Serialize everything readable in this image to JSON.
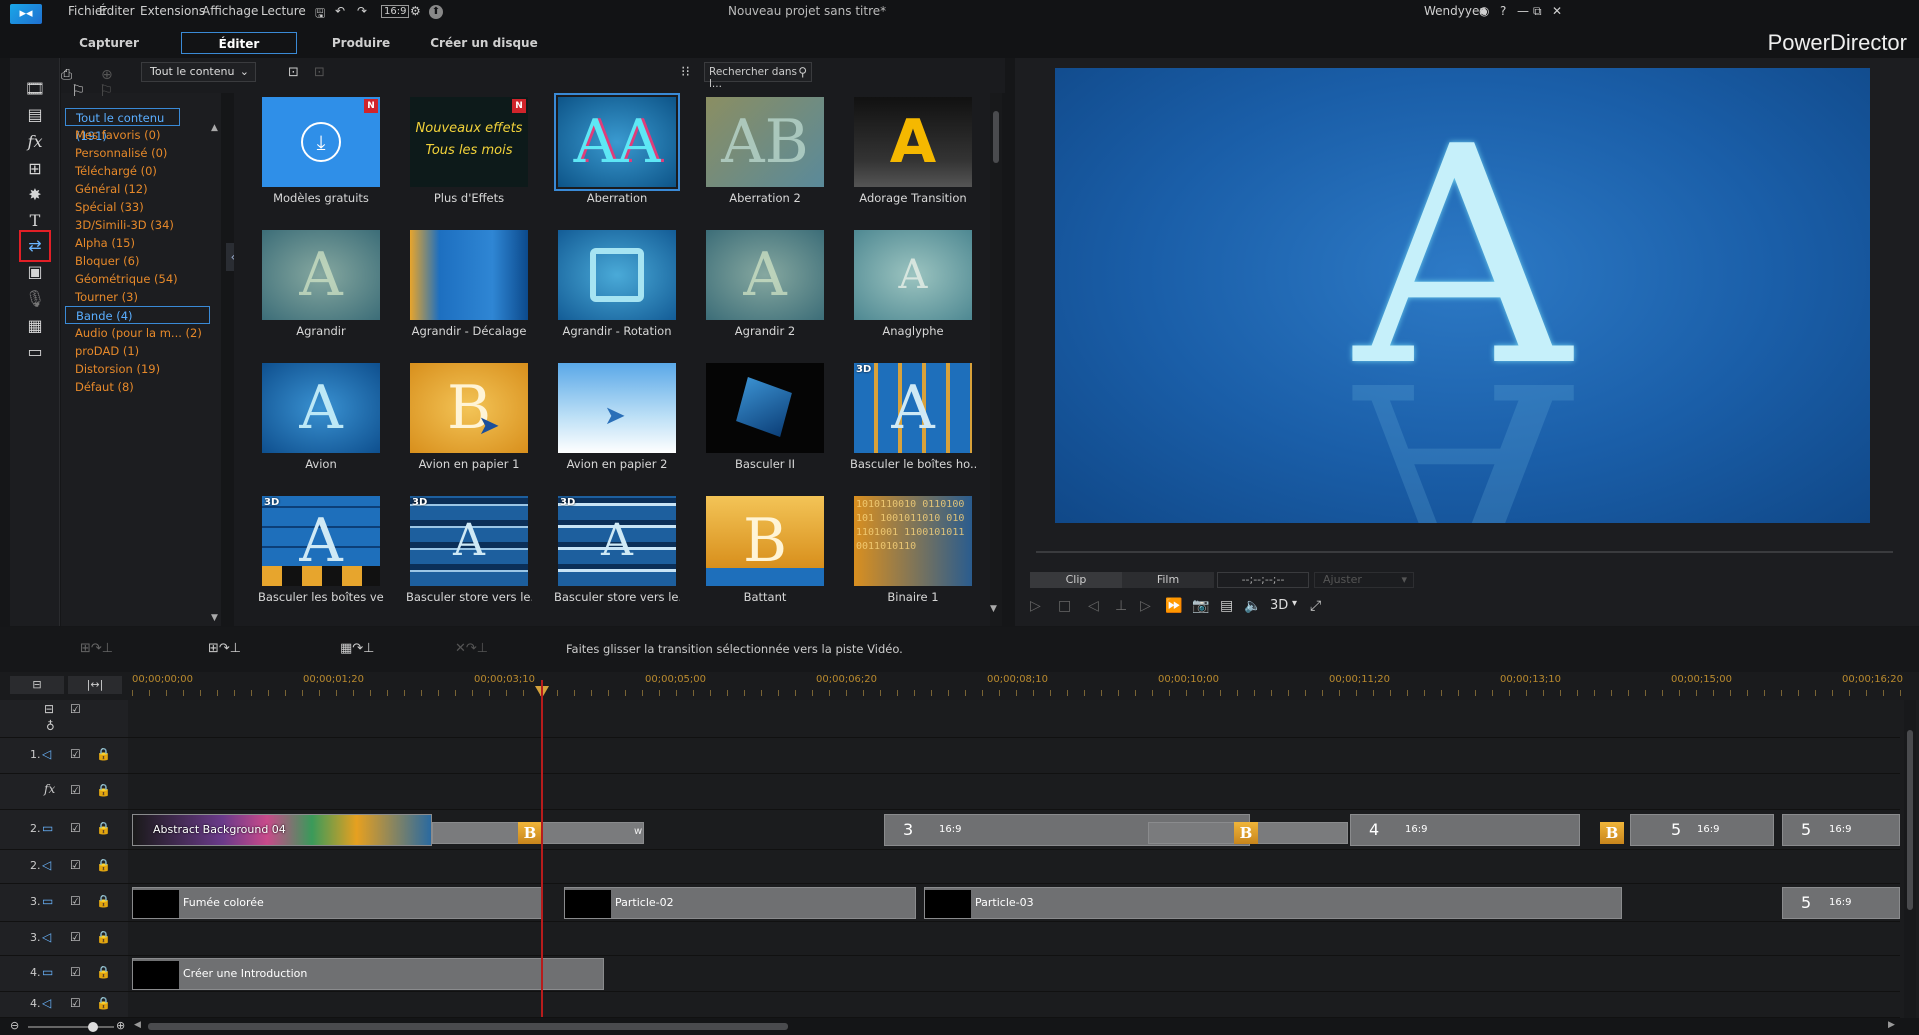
{
  "menubar": {
    "items": [
      "Fichier",
      "Éditer",
      "Extensions",
      "Affichage",
      "Lecture"
    ],
    "project_title": "Nouveau projet sans titre*",
    "user": "Wendyyen"
  },
  "modes": [
    "Capturer",
    "Éditer",
    "Produire",
    "Créer un disque"
  ],
  "brand": "PowerDirector",
  "library": {
    "filter_label": "Tout le contenu",
    "search_placeholder": "Rechercher dans l..."
  },
  "categories": [
    "Tout le contenu (191)",
    "Mes favoris (0)",
    "Personnalisé (0)",
    "Téléchargé (0)",
    "Général (12)",
    "Spécial (33)",
    "3D/Simili-3D (34)",
    "Alpha (15)",
    "Bloquer (6)",
    "Géométrique (54)",
    "Tourner (3)",
    "Bande (4)",
    "Audio (pour la m... (2)",
    "proDAD (1)",
    "Distorsion (19)",
    "Défaut (8)"
  ],
  "tiles": [
    {
      "label": "Modèles gratuits",
      "badge": "N"
    },
    {
      "label": "Plus d'Effets",
      "badge": "N",
      "line1": "Nouveaux effets",
      "line2": "Tous les mois"
    },
    {
      "label": "Aberration",
      "glyph": "AA"
    },
    {
      "label": "Aberration 2",
      "glyph": "AB"
    },
    {
      "label": "Adorage Transition",
      "glyph": "A"
    },
    {
      "label": "Agrandir",
      "glyph": "A"
    },
    {
      "label": "Agrandir - Décalage"
    },
    {
      "label": "Agrandir - Rotation"
    },
    {
      "label": "Agrandir 2",
      "glyph": "A"
    },
    {
      "label": "Anaglyphe",
      "glyph": "A"
    },
    {
      "label": "Avion",
      "glyph": "A"
    },
    {
      "label": "Avion en papier 1",
      "glyph": "B"
    },
    {
      "label": "Avion en papier 2"
    },
    {
      "label": "Basculer II"
    },
    {
      "label": "Basculer le boîtes ho...",
      "badge3d": "3D",
      "glyph": "A"
    },
    {
      "label": "Basculer les boîtes ve...",
      "badge3d": "3D",
      "glyph": "A"
    },
    {
      "label": "Basculer store vers le...",
      "badge3d": "3D",
      "glyph": "A"
    },
    {
      "label": "Basculer store vers le...",
      "badge3d": "3D",
      "glyph": "A"
    },
    {
      "label": "Battant",
      "glyph": "B"
    },
    {
      "label": "Binaire 1",
      "glyph": "A",
      "binary": "1010110010 0110100101 1001011010 0101101001 1100101011 0011010110"
    }
  ],
  "preview": {
    "glyph": "A",
    "clip_btn": "Clip",
    "film_btn": "Film",
    "timecode": "--;--;--;--",
    "fit_label": "Ajuster",
    "mode3d": "3D"
  },
  "timeline": {
    "hint": "Faites glisser la transition sélectionnée vers la piste Vidéo.",
    "ruler": [
      "00;00;00;00",
      "00;00;01;20",
      "00;00;03;10",
      "00;00;05;00",
      "00;00;06;20",
      "00;00;08;10",
      "00;00;10;00",
      "00;00;11;20",
      "00;00;13;10",
      "00;00;15;00",
      "00;00;16;20"
    ],
    "track_labels": [
      "1.",
      "",
      "2.",
      "2.",
      "3.",
      "3.",
      "4.",
      "4."
    ],
    "clips": {
      "abstract": "Abstract Background 04",
      "fumee": "Fumée colorée",
      "particle2": "Particle-02",
      "particle3": "Particle-03",
      "intro": "Créer une Introduction",
      "ratio": "16:9",
      "n3": "3",
      "n4": "4",
      "n5": "5",
      "trans_b": "B",
      "w": "w"
    }
  },
  "colors": {
    "accent": "#3a8ad6",
    "category_text": "#e6892a",
    "playhead": "#b71c1c",
    "transition": "#e8a32c",
    "highlight_red": "#e21f26"
  }
}
